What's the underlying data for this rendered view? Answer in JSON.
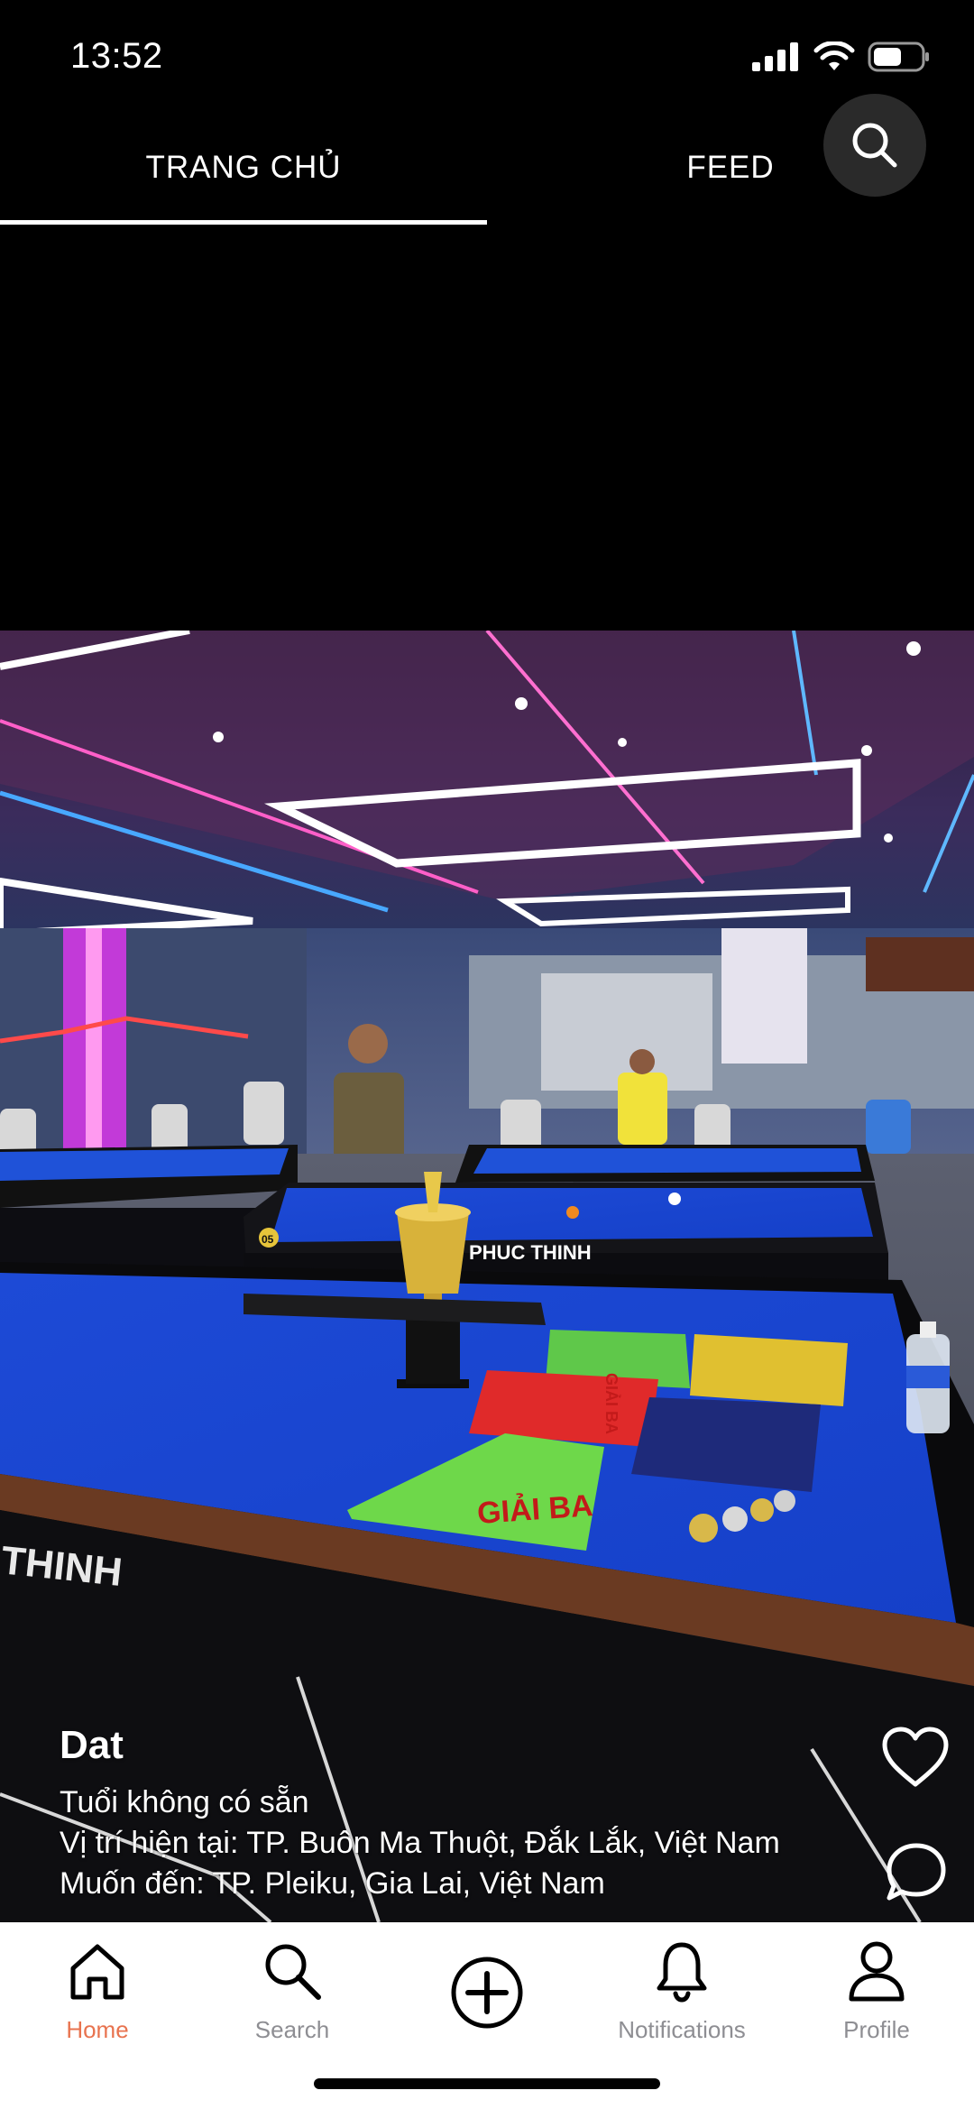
{
  "status_bar": {
    "time": "13:52"
  },
  "top_tabs": {
    "home": "TRANG CHỦ",
    "feed": "FEED"
  },
  "post": {
    "user_name": "Dat",
    "age": "Tuổi không có sẵn",
    "current_location": "Vị trí hiện tại: TP. Buôn Ma Thuột, Đắk Lắk, Việt Nam",
    "destination": "Muốn đến: TP. Pleiku, Gia Lai, Việt Nam"
  },
  "bottom_nav": {
    "items": [
      {
        "label": "Home",
        "icon": "home-icon",
        "active": true
      },
      {
        "label": "Search",
        "icon": "search-icon",
        "active": false
      },
      {
        "label": "",
        "icon": "add-circle-icon",
        "active": false
      },
      {
        "label": "Notifications",
        "icon": "bell-icon",
        "active": false
      },
      {
        "label": "Profile",
        "icon": "person-icon",
        "active": false
      }
    ]
  },
  "photo": {
    "table_brand": "PHUC THINH",
    "table_brand_front": "THINH",
    "table_number": "05",
    "banner_1": "GIẢI BA",
    "banner_2": "GIẢI BA"
  },
  "colors": {
    "accent": "#e8734f",
    "felt": "#1f4fd8"
  }
}
